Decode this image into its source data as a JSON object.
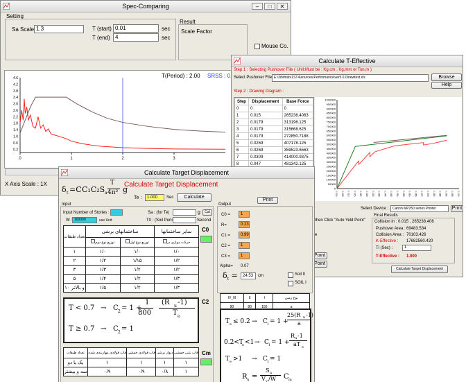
{
  "spec": {
    "title": "Spec-Comparing",
    "setting_label": "Setting",
    "sa_scale_label": "Sa Scale :",
    "sa_scale_value": "1.3",
    "t_start_label": "T (start)",
    "t_start_value": "0.01",
    "t_end_label": "T (end)",
    "t_end_value": "4",
    "sec1": "sec",
    "sec2": "sec",
    "result_label": "Result",
    "scale_factor_label": "Scale Factor",
    "mouse_label": "Mouse Co.",
    "period_text": "T(Period) : 2.00",
    "srss_text": "SRSS : 0.2",
    "x_axis_scale": "X Axis Scale : 1X"
  },
  "spec_chart_data": {
    "type": "line",
    "xlim": [
      0,
      4
    ],
    "ylim": [
      0,
      4.6
    ],
    "x_ticks": [
      "0",
      "1",
      "2",
      "3"
    ],
    "y_ticks": [
      "4.6",
      "4.2",
      "3.8",
      "3.4",
      "3.0",
      "2.6",
      "2.2",
      "1.8",
      "1.4",
      "1.0",
      "0.6",
      "0.2"
    ],
    "period_marker": 2.0,
    "series": [
      {
        "color": "#7a5c5c",
        "points": [
          [
            0,
            1.2
          ],
          [
            0.1,
            2.0
          ],
          [
            0.2,
            2.8
          ],
          [
            0.3,
            3.4
          ],
          [
            0.5,
            3.4
          ],
          [
            0.7,
            3.4
          ],
          [
            0.9,
            3.4
          ],
          [
            1.1,
            3.0
          ],
          [
            1.4,
            2.5
          ],
          [
            1.7,
            2.1
          ],
          [
            2.0,
            1.85
          ],
          [
            2.5,
            1.6
          ],
          [
            3.0,
            1.42
          ],
          [
            3.5,
            1.32
          ],
          [
            4.0,
            1.25
          ]
        ]
      },
      {
        "color": "#ff2020",
        "points": [
          [
            0,
            1.8
          ],
          [
            0.03,
            2.6
          ],
          [
            0.06,
            2.0
          ],
          [
            0.08,
            3.3
          ],
          [
            0.1,
            2.4
          ],
          [
            0.13,
            2.8
          ],
          [
            0.16,
            2.0
          ],
          [
            0.2,
            2.3
          ],
          [
            0.25,
            1.6
          ],
          [
            0.3,
            1.5
          ],
          [
            0.35,
            2.2
          ],
          [
            0.4,
            1.5
          ],
          [
            0.45,
            1.7
          ],
          [
            0.5,
            1.3
          ],
          [
            0.55,
            1.45
          ],
          [
            0.6,
            1.15
          ],
          [
            0.7,
            1.05
          ],
          [
            0.8,
            0.95
          ],
          [
            0.9,
            0.85
          ],
          [
            1.0,
            0.7
          ],
          [
            1.2,
            0.55
          ],
          [
            1.4,
            0.45
          ],
          [
            1.6,
            0.38
          ],
          [
            2.0,
            0.3
          ],
          [
            2.5,
            0.25
          ],
          [
            3.0,
            0.22
          ],
          [
            4.0,
            0.2
          ]
        ]
      }
    ]
  },
  "teff": {
    "title": "Calculate T-Effective",
    "step1": "Step 1 : Selecting Pushover File ( Unit:Must be : Kg,cm , Kg,mm or Ton,m )",
    "select_label": "Select Pushover File :",
    "path": "E:\\3d\\tmsb\\1ST4\\sources\\Performance\\ver5.0.0\\newtest.xls",
    "browse": "Browse",
    "help": "Help",
    "step2": "Step 2 : Drawing Diagram :",
    "col_step": "Step",
    "col_disp": "Displacement",
    "col_force": "Base Force",
    "rows": [
      [
        "0",
        "0",
        "0"
      ],
      [
        "1",
        "0.015",
        "265238.4063"
      ],
      [
        "2",
        "0.0179",
        "313196.125"
      ],
      [
        "3",
        "0.0179",
        "315668.625"
      ],
      [
        "4",
        "0.0179",
        "272850.7188"
      ],
      [
        "5",
        "0.0269",
        "407178.125"
      ],
      [
        "6",
        "0.0269",
        "359523.6563"
      ],
      [
        "7",
        "0.0309",
        "414000.9375"
      ],
      [
        "8",
        "0.047",
        "481342.125"
      ],
      [
        "9",
        "0.062",
        "504554.5313"
      ],
      [
        "10",
        "0.0708",
        "518187.1875"
      ],
      [
        "11",
        "0.0708",
        "491670"
      ],
      [
        "12",
        "0.0779",
        "506317.875"
      ]
    ],
    "select_device_label": "Select Device :",
    "device": "Canon MP250 series Printer",
    "print": "Print",
    "auto_yield_hint": "then Click \"Auto Yeld Point\"",
    "final_results": "Final Results",
    "collision_line": "Collision in : 0.015 , 265238.406",
    "pushover_area_label": "Pushover Area :",
    "pushover_area": "69483.534",
    "collision_area_label": "Collision Area :",
    "collision_area": "70103.426",
    "keff_label": "K-Effective :",
    "keff": "17682560.420",
    "ti_label": "Ti (Sec) :",
    "ti_value": "1",
    "teff_label": "T-Effective :",
    "teff_value": "1.000",
    "btn_calc_target": "Calculate Target Displacement",
    "btn_point1": "Point",
    "btn_point2": "Point",
    "partial_e": "e"
  },
  "teff_chart_data": {
    "type": "line",
    "xlim": [
      0,
      0.1
    ],
    "ylim": [
      0,
      1000000
    ],
    "x_ticks": [
      "0.000",
      "0.005",
      "0.010",
      "0.015",
      "0.020",
      "0.025",
      "0.030",
      "0.035",
      "0.040",
      "0.045",
      "0.050",
      "0.055",
      "0.060",
      "0.065",
      "0.070",
      "0.075",
      "0.080",
      "0.085",
      "0.090",
      "0.095",
      "0.100"
    ],
    "y_ticks": [
      "1000000",
      "950000",
      "900000",
      "850000",
      "800000",
      "750000",
      "700000",
      "650000",
      "600000",
      "550000",
      "500000",
      "450000",
      "400000",
      "350000",
      "300000",
      "250000",
      "200000",
      "150000",
      "100000",
      "50000",
      "0"
    ],
    "series": [
      {
        "color": "#ff4040",
        "points": [
          [
            0,
            0
          ],
          [
            0.015,
            265238
          ],
          [
            0.0179,
            313196
          ],
          [
            0.0179,
            315668
          ],
          [
            0.0179,
            272850
          ],
          [
            0.0269,
            407178
          ],
          [
            0.0269,
            359523
          ],
          [
            0.0309,
            414000
          ],
          [
            0.047,
            481342
          ],
          [
            0.062,
            504554
          ],
          [
            0.0708,
            518187
          ],
          [
            0.0708,
            491670
          ],
          [
            0.0779,
            506317
          ],
          [
            0.09,
            545000
          ]
        ]
      },
      {
        "color": "#208020",
        "points": [
          [
            0,
            0
          ],
          [
            0.015,
            475000
          ],
          [
            0.09,
            595000
          ]
        ]
      },
      {
        "color": "#7a5c5c",
        "points": [
          [
            0.03,
            520000
          ],
          [
            0.09,
            600000
          ]
        ]
      }
    ]
  },
  "target": {
    "title": "Calculate Target Displacement",
    "heading": "Calculate Target Displacement",
    "te_label": "Te :",
    "te_value": "1.000",
    "te_unit": "Sec",
    "btn_calculate": "Calculate",
    "btn_print": "Print",
    "input_label": "Input",
    "stories_label": "Input Number of Stories :",
    "sa_label": "Sa : (for Te)",
    "sa_unit": "g",
    "btn_cal": "Cal",
    "w_label": "W :",
    "w_value": "100000",
    "w_unit": "use Unit",
    "t0_label": "T0 : (Soil Period)",
    "t0_unit": "Second",
    "c0_label": "C0",
    "c2_label": "C2",
    "cm_label": "Cm",
    "output_label": "Output",
    "c0": "C0 =",
    "c0_val": "1",
    "r": "R=",
    "r_val": "0.23",
    "c1": "C1 =",
    "c1_val": "0.99",
    "c2": "C2 =",
    "c2_val": "1",
    "c3": "C3 =",
    "c3_val": "1",
    "alpha_label": "Alpha=",
    "alpha_val": "0.07",
    "dt_val": "24.53",
    "dt_unit": "cm",
    "soil2": "Soil II",
    "soil1": "SOIL I",
    "story_header": "تعداد طبقات",
    "header_linear": "سایر ساختمانها",
    "header_shear": "ساختمانهای برشی",
    "sub1": "حرکت موازی در",
    "sub2": "توزیع نوع اول",
    "sub3": "توزیع نوع دوم",
    "c0_rows": [
      [
        "۱",
        "۱/۰",
        "۱/۰",
        "۱/۰"
      ],
      [
        "۲",
        "۱/۲",
        "۱/۱۵",
        "۱/۲"
      ],
      [
        "۳",
        "۱/۳",
        "۱/۲",
        "۱/۲"
      ],
      [
        "۵",
        "۱/۴",
        "۱/۲",
        "۱/۳"
      ],
      [
        "۱۰ و بالاتر",
        "۱/۵",
        "۱/۲",
        "۱/۳"
      ]
    ],
    "small_head": [
      "IV_III",
      "II",
      "I",
      "نوع زمین"
    ],
    "small_vals": [
      "90",
      "80",
      "150",
      "a"
    ],
    "f1_a": "T < 0.7",
    "f1_b": "C",
    "f1_c": "= 1 +",
    "f1_d": "1",
    "f1_e": "800",
    "f1_f": "(R",
    "f1_g": "-1)",
    "f1_h": "T",
    "f2_a": "T ≥ 0.7",
    "f2_b": "C",
    "f2_c": "= 1",
    "g1_a": "T",
    "g1_b": "≤ 0.2",
    "g1_c": "C",
    "g1_d": "= 1 +",
    "g1_e": "25(R",
    "g1_f": "-1)",
    "g1_g": "a",
    "g2_a": "0.2<T",
    "g2_b": "<1",
    "g2_c": "C",
    "g2_d": "= 1 +",
    "g2_e": "R",
    "g2_f": "-1",
    "g2_g": "aT",
    "g3_a": "T",
    "g3_b": ">1",
    "g3_c": "C",
    "g3_d": "= 1",
    "ru_a": "R",
    "ru_b": "=",
    "ru_c": "S",
    "ru_d": "V",
    "ru_e": "/W",
    "ru_f": "C",
    "cm_headers": [
      "تعداد طبقات",
      "قاب فولادی مهاربندی شده",
      "قاب فولادی خمشی",
      "دیوار برشی",
      "قاب بتنی خمشی"
    ],
    "cm_rows": [
      [
        "یک یا دو",
        "۱",
        "۱",
        "۱",
        "۱"
      ],
      [
        "سه و بیشتر",
        "۰/۹",
        "۰/۹",
        "۰/۸",
        "۱"
      ]
    ],
    "formula_main": "δ",
    "formula_t": "t",
    "formula_eq": "=C",
    "formula_rest": "C₁C₂S",
    "formula_a": "a",
    "formula_te2": "T",
    "formula_den": "4π²",
    "formula_g": "g"
  }
}
